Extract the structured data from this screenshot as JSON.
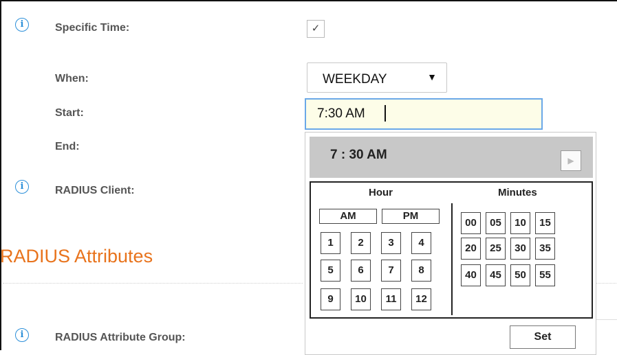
{
  "form": {
    "specific_time_label": "Specific Time:",
    "specific_time_checked": "✓",
    "when_label": "When:",
    "start_label": "Start:",
    "end_label": "End:",
    "radius_client_label": "RADIUS Client:",
    "when_value": "WEEKDAY",
    "start_value": "7:30 AM",
    "info_icon": "i"
  },
  "section": {
    "title": "RADIUS Attributes",
    "attribute_group_label": "RADIUS Attribute Group:"
  },
  "picker": {
    "selected_time": "7 : 30 AM",
    "next_icon": "▶",
    "hour_title": "Hour",
    "minutes_title": "Minutes",
    "am_label": "AM",
    "pm_label": "PM",
    "hours": [
      "1",
      "2",
      "3",
      "4",
      "5",
      "6",
      "7",
      "8",
      "9",
      "10",
      "11",
      "12"
    ],
    "minutes": [
      "00",
      "05",
      "10",
      "15",
      "20",
      "25",
      "30",
      "35",
      "40",
      "45",
      "50",
      "55"
    ],
    "set_label": "Set"
  },
  "colors": {
    "accent_orange": "#e8731c",
    "info_blue": "#2b8fd9",
    "focus_blue": "#6aa8e8",
    "input_bg": "#fdfde8"
  }
}
